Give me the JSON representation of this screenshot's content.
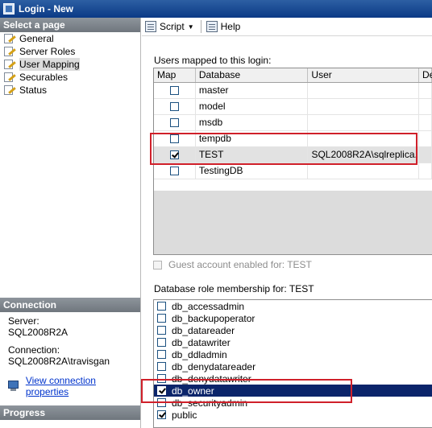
{
  "window": {
    "title": "Login - New"
  },
  "left_panel": {
    "select_page_header": "Select a page",
    "pages": [
      {
        "label": "General",
        "selected": false
      },
      {
        "label": "Server Roles",
        "selected": false
      },
      {
        "label": "User Mapping",
        "selected": true
      },
      {
        "label": "Securables",
        "selected": false
      },
      {
        "label": "Status",
        "selected": false
      }
    ],
    "connection_header": "Connection",
    "server_label": "Server:",
    "server_value": "SQL2008R2A",
    "connection_label": "Connection:",
    "connection_value": "SQL2008R2A\\travisgan",
    "view_connection_link": "View connection properties",
    "progress_header": "Progress"
  },
  "toolbar": {
    "script_label": "Script",
    "help_label": "Help"
  },
  "users_mapped": {
    "label": "Users mapped to this login:",
    "columns": [
      "Map",
      "Database",
      "User",
      "De"
    ],
    "rows": [
      {
        "map": false,
        "database": "master",
        "user": ""
      },
      {
        "map": false,
        "database": "model",
        "user": ""
      },
      {
        "map": false,
        "database": "msdb",
        "user": ""
      },
      {
        "map": false,
        "database": "tempdb",
        "user": ""
      },
      {
        "map": true,
        "database": "TEST",
        "user": "SQL2008R2A\\sqlreplica..."
      },
      {
        "map": false,
        "database": "TestingDB",
        "user": ""
      }
    ]
  },
  "guest_account": {
    "label": "Guest account enabled for: TEST",
    "checked": false
  },
  "role_membership": {
    "label": "Database role membership for: TEST",
    "roles": [
      {
        "name": "db_accessadmin",
        "checked": false
      },
      {
        "name": "db_backupoperator",
        "checked": false
      },
      {
        "name": "db_datareader",
        "checked": false
      },
      {
        "name": "db_datawriter",
        "checked": false
      },
      {
        "name": "db_ddladmin",
        "checked": false
      },
      {
        "name": "db_denydatareader",
        "checked": false
      },
      {
        "name": "db_denydatawriter",
        "checked": false
      },
      {
        "name": "db_owner",
        "checked": true,
        "selected": true
      },
      {
        "name": "db_securityadmin",
        "checked": false
      },
      {
        "name": "public",
        "checked": true
      }
    ]
  },
  "colors": {
    "highlight_box": "#d0202a",
    "selection": "#0b246a",
    "header_gray": "#7f868d"
  }
}
